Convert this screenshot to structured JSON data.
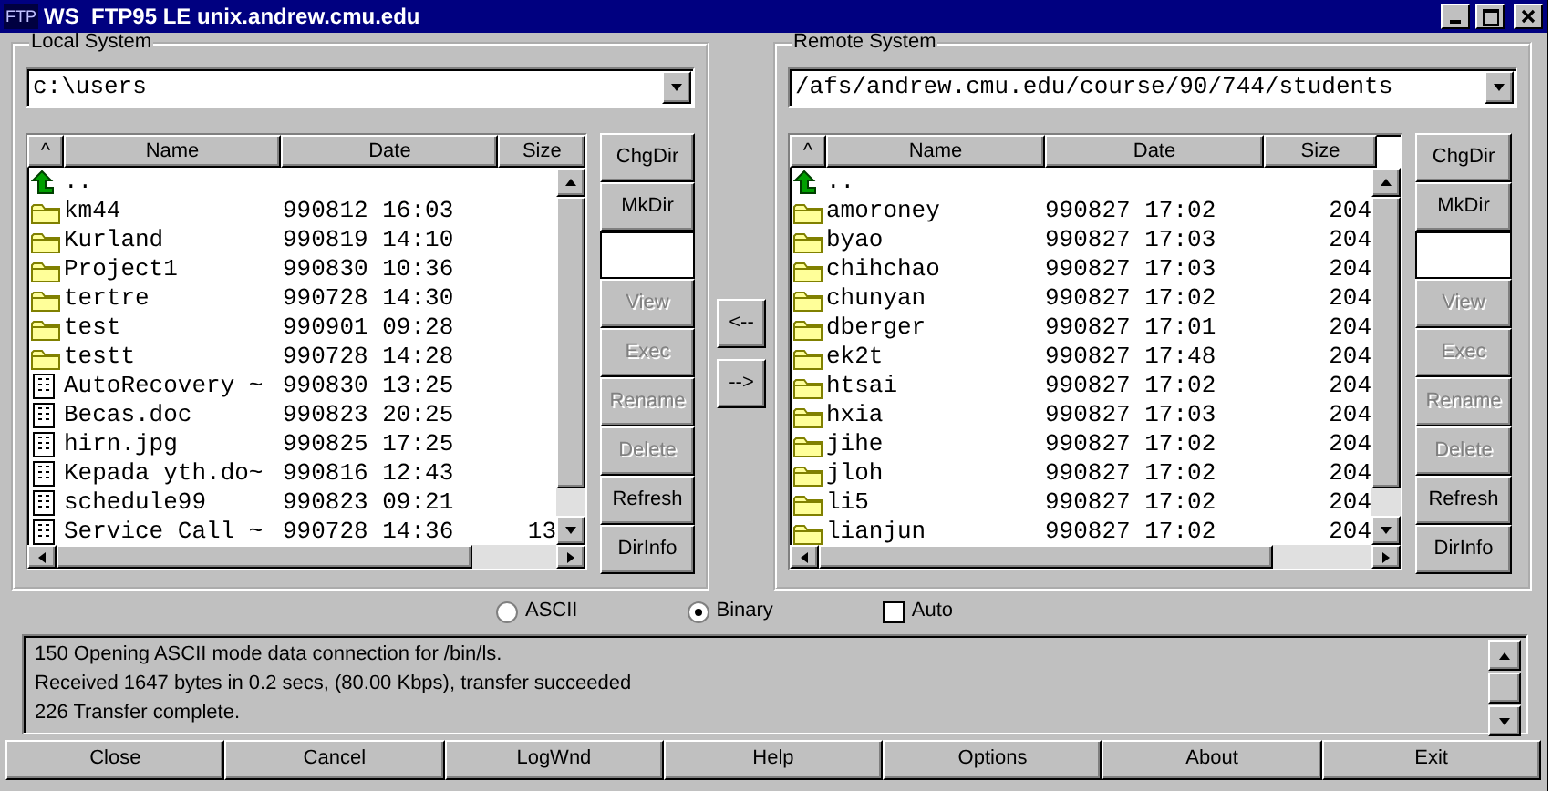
{
  "window": {
    "icon_label": "FTP",
    "title": "WS_FTP95 LE unix.andrew.cmu.edu"
  },
  "local": {
    "label": "Local System",
    "path": "c:\\users",
    "sort_mark": "^",
    "columns": [
      "Name",
      "Date",
      "Size"
    ],
    "rows": [
      {
        "kind": "up",
        "name": ".."
      },
      {
        "kind": "folder",
        "name": "km44",
        "date": "990812 16:03"
      },
      {
        "kind": "folder",
        "name": "Kurland",
        "date": "990819 14:10"
      },
      {
        "kind": "folder",
        "name": "Project1",
        "date": "990830 10:36"
      },
      {
        "kind": "folder",
        "name": "tertre",
        "date": "990728 14:30"
      },
      {
        "kind": "folder",
        "name": "test",
        "date": "990901 09:28"
      },
      {
        "kind": "folder",
        "name": "testt",
        "date": "990728 14:28"
      },
      {
        "kind": "file",
        "name": "AutoRecovery ~",
        "date": "990830 13:25"
      },
      {
        "kind": "file",
        "name": "Becas.doc",
        "date": "990823 20:25"
      },
      {
        "kind": "file",
        "name": "hirn.jpg",
        "date": "990825 17:25"
      },
      {
        "kind": "file",
        "name": "Kepada yth.do~",
        "date": "990816 12:43"
      },
      {
        "kind": "file",
        "name": "schedule99",
        "date": "990823 09:21"
      },
      {
        "kind": "file",
        "name": "Service Call ~",
        "date": "990728 14:36",
        "size": "13"
      }
    ],
    "buttons": [
      {
        "kind": "button",
        "label": "ChgDir",
        "disabled": false
      },
      {
        "kind": "button",
        "label": "MkDir",
        "disabled": false
      },
      {
        "kind": "field"
      },
      {
        "kind": "button",
        "label": "View",
        "disabled": true
      },
      {
        "kind": "button",
        "label": "Exec",
        "disabled": true
      },
      {
        "kind": "button",
        "label": "Rename",
        "disabled": true
      },
      {
        "kind": "button",
        "label": "Delete",
        "disabled": true
      },
      {
        "kind": "button",
        "label": "Refresh",
        "disabled": false
      },
      {
        "kind": "button",
        "label": "DirInfo",
        "disabled": false
      }
    ]
  },
  "transfer": [
    "<--",
    "-->"
  ],
  "remote": {
    "label": "Remote System",
    "path": "/afs/andrew.cmu.edu/course/90/744/students",
    "sort_mark": "^",
    "columns": [
      "Name",
      "Date",
      "Size"
    ],
    "rows": [
      {
        "kind": "up",
        "name": ".."
      },
      {
        "kind": "folder",
        "name": "amoroney",
        "date": "990827 17:02",
        "size": "204"
      },
      {
        "kind": "folder",
        "name": "byao",
        "date": "990827 17:03",
        "size": "204"
      },
      {
        "kind": "folder",
        "name": "chihchao",
        "date": "990827 17:03",
        "size": "204"
      },
      {
        "kind": "folder",
        "name": "chunyan",
        "date": "990827 17:02",
        "size": "204"
      },
      {
        "kind": "folder",
        "name": "dberger",
        "date": "990827 17:01",
        "size": "204"
      },
      {
        "kind": "folder",
        "name": "ek2t",
        "date": "990827 17:48",
        "size": "204"
      },
      {
        "kind": "folder",
        "name": "htsai",
        "date": "990827 17:02",
        "size": "204"
      },
      {
        "kind": "folder",
        "name": "hxia",
        "date": "990827 17:03",
        "size": "204"
      },
      {
        "kind": "folder",
        "name": "jihe",
        "date": "990827 17:02",
        "size": "204"
      },
      {
        "kind": "folder",
        "name": "jloh",
        "date": "990827 17:02",
        "size": "204"
      },
      {
        "kind": "folder",
        "name": "li5",
        "date": "990827 17:02",
        "size": "204"
      },
      {
        "kind": "folder",
        "name": "lianjun",
        "date": "990827 17:02",
        "size": "204"
      }
    ],
    "buttons": [
      {
        "kind": "button",
        "label": "ChgDir",
        "disabled": false
      },
      {
        "kind": "button",
        "label": "MkDir",
        "disabled": false
      },
      {
        "kind": "field"
      },
      {
        "kind": "button",
        "label": "View",
        "disabled": true
      },
      {
        "kind": "button",
        "label": "Exec",
        "disabled": true
      },
      {
        "kind": "button",
        "label": "Rename",
        "disabled": true
      },
      {
        "kind": "button",
        "label": "Delete",
        "disabled": true
      },
      {
        "kind": "button",
        "label": "Refresh",
        "disabled": false
      },
      {
        "kind": "button",
        "label": "DirInfo",
        "disabled": false
      }
    ]
  },
  "mode": {
    "options": [
      {
        "label": "ASCII",
        "selected": false
      },
      {
        "label": "Binary",
        "selected": true
      }
    ],
    "auto": {
      "label": "Auto",
      "checked": false
    }
  },
  "log": [
    "150 Opening ASCII mode data connection for /bin/ls.",
    "Received 1647 bytes in 0.2 secs, (80.00 Kbps), transfer succeeded",
    "226 Transfer complete."
  ],
  "buttons": [
    "Close",
    "Cancel",
    "LogWnd",
    "Help",
    "Options",
    "About",
    "Exit"
  ]
}
